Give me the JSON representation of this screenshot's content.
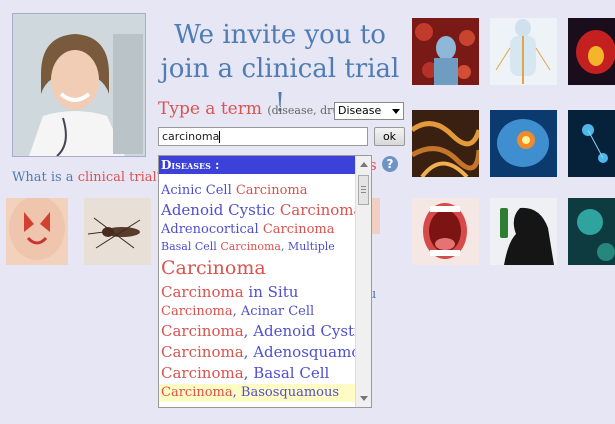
{
  "headline": {
    "line1": "We invite you to",
    "line2": "join a clinical trial !"
  },
  "question": {
    "prefix": "What is a ",
    "link": "clinical trial?"
  },
  "search": {
    "label": "Type a term",
    "hint": "(disease, drug...)",
    "type_selected": "Disease",
    "value": "carcinoma",
    "button_label": "ok",
    "help_glyph": "?"
  },
  "background_fragments": {
    "s": "s",
    "u": "u"
  },
  "dropdown": {
    "header": "Diseases :",
    "items": [
      {
        "pre": "Acinic Cell ",
        "hl": "Carcinoma",
        "post": "",
        "size": 13
      },
      {
        "pre": "Adenoid Cystic ",
        "hl": "Carcinoma",
        "post": "",
        "size": 15
      },
      {
        "pre": "Adrenocortical ",
        "hl": "Carcinoma",
        "post": "",
        "size": 13
      },
      {
        "pre": "Basal Cell ",
        "hl": "Carcinoma",
        "post": ", Multiple",
        "size": 11
      },
      {
        "pre": "",
        "hl": "Carcinoma",
        "post": "",
        "size": 19
      },
      {
        "pre": "",
        "hl": "Carcinoma",
        "post": " in Situ",
        "size": 15
      },
      {
        "pre": "",
        "hl": "Carcinoma",
        "post": ", Acinar Cell",
        "size": 13
      },
      {
        "pre": "",
        "hl": "Carcinoma",
        "post": ", Adenoid Cystic",
        "size": 15
      },
      {
        "pre": "",
        "hl": "Carcinoma",
        "post": ", Adenosquamous",
        "size": 15
      },
      {
        "pre": "",
        "hl": "Carcinoma",
        "post": ", Basal Cell",
        "size": 15
      },
      {
        "pre": "",
        "hl": "Carcinoma",
        "post": ", Basosquamous",
        "size": 13
      }
    ]
  },
  "colors": {
    "background": "#e6e6f5",
    "headline": "#4f7db3",
    "accent_red": "#d9534f",
    "dropdown_header": "#3b41d9",
    "item_blue": "#4f4fd0"
  },
  "images": [
    "doctor-photo",
    "virus-body-illustration",
    "nervous-system-illustration",
    "brain-glow-illustration",
    "dna-strands-illustration",
    "brain-scan-illustration",
    "neurons-illustration",
    "nasal-sinus-illustration",
    "mosquito-photo",
    "open-mouth-illustration",
    "drinking-silhouette-illustration",
    "virus-cells-illustration"
  ]
}
